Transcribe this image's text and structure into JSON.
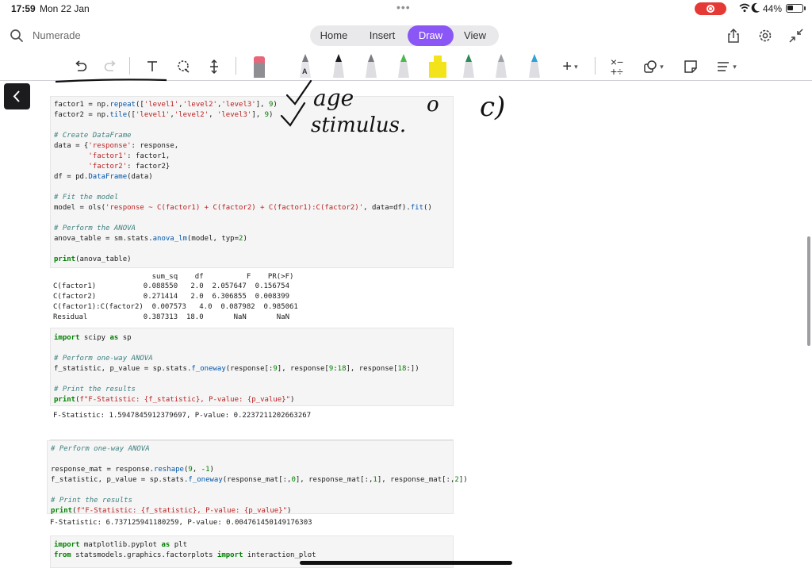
{
  "status": {
    "time": "17:59",
    "date": "Mon 22 Jan",
    "battery": "44%",
    "battery_fraction": 0.44
  },
  "topbar": {
    "app_name": "Numerade",
    "tabs": [
      {
        "label": "Home"
      },
      {
        "label": "Insert"
      },
      {
        "label": "Draw",
        "active": true
      },
      {
        "label": "View"
      }
    ]
  },
  "toolbar": {
    "tools": [
      "undo-icon",
      "redo-icon",
      "text-tool-icon",
      "lasso-icon",
      "insert-space-icon",
      "eraser-icon",
      "pen-icon",
      "pencil-icon",
      "highlighter-icon",
      "add-icon",
      "math-icon",
      "shapes-icon",
      "sticky-note-icon",
      "ink-to-text-icon"
    ],
    "pen_colors": [
      "#7a7a80",
      "#1c1c1e",
      "#7a7a80",
      "#4ab84a",
      "#f2e31a",
      "#2e8b57",
      "#9aa0a6",
      "#2fa3d8"
    ]
  },
  "colors": {
    "accent": "#8a56f5",
    "record": "#e53935"
  },
  "notebook": {
    "cell1": {
      "lines": [
        [
          [
            "t",
            "factor1 = np."
          ],
          [
            "fn",
            "repeat"
          ],
          [
            "t",
            "(["
          ],
          [
            "st",
            "'level1'"
          ],
          [
            "t",
            ","
          ],
          [
            "st",
            "'level2'"
          ],
          [
            "t",
            ","
          ],
          [
            "st",
            "'level3'"
          ],
          [
            "t",
            "], "
          ],
          [
            "nu",
            "9"
          ],
          [
            "t",
            ")"
          ]
        ],
        [
          [
            "t",
            "factor2 = np."
          ],
          [
            "fn",
            "tile"
          ],
          [
            "t",
            "(["
          ],
          [
            "st",
            "'level1'"
          ],
          [
            "t",
            ","
          ],
          [
            "st",
            "'level2'"
          ],
          [
            "t",
            ", "
          ],
          [
            "st",
            "'level3'"
          ],
          [
            "t",
            "], "
          ],
          [
            "nu",
            "9"
          ],
          [
            "t",
            ")"
          ]
        ],
        [
          [
            "t",
            ""
          ]
        ],
        [
          [
            "cm",
            "# Create DataFrame"
          ]
        ],
        [
          [
            "t",
            "data = {"
          ],
          [
            "st",
            "'response'"
          ],
          [
            "t",
            ": response,"
          ]
        ],
        [
          [
            "t",
            "        "
          ],
          [
            "st",
            "'factor1'"
          ],
          [
            "t",
            ": factor1,"
          ]
        ],
        [
          [
            "t",
            "        "
          ],
          [
            "st",
            "'factor2'"
          ],
          [
            "t",
            ": factor2}"
          ]
        ],
        [
          [
            "t",
            "df = pd."
          ],
          [
            "fn",
            "DataFrame"
          ],
          [
            "t",
            "(data)"
          ]
        ],
        [
          [
            "t",
            ""
          ]
        ],
        [
          [
            "cm",
            "# Fit the model"
          ]
        ],
        [
          [
            "t",
            "model = ols("
          ],
          [
            "st",
            "'response ~ C(factor1) + C(factor2) + C(factor1):C(factor2)'"
          ],
          [
            "t",
            ", data=df)."
          ],
          [
            "fn",
            "fit"
          ],
          [
            "t",
            "()"
          ]
        ],
        [
          [
            "t",
            ""
          ]
        ],
        [
          [
            "cm",
            "# Perform the ANOVA"
          ]
        ],
        [
          [
            "t",
            "anova_table = sm.stats."
          ],
          [
            "fn",
            "anova_lm"
          ],
          [
            "t",
            "(model, typ="
          ],
          [
            "nu",
            "2"
          ],
          [
            "t",
            ")"
          ]
        ],
        [
          [
            "t",
            ""
          ]
        ],
        [
          [
            "kw",
            "print"
          ],
          [
            "t",
            "(anova_table)"
          ]
        ]
      ]
    },
    "anova_output": {
      "header": "                       sum_sq    df          F    PR(>F)",
      "rows": [
        "C(factor1)           0.088550   2.0  2.057647  0.156754",
        "C(factor2)           0.271414   2.0  6.306855  0.008399",
        "C(factor1):C(factor2)  0.007573   4.0  0.087982  0.985061",
        "Residual             0.387313  18.0       NaN       NaN"
      ]
    },
    "cell2": {
      "lines": [
        [
          [
            "kw",
            "import"
          ],
          [
            "t",
            " scipy "
          ],
          [
            "kw",
            "as"
          ],
          [
            "t",
            " sp"
          ]
        ],
        [
          [
            "t",
            ""
          ]
        ],
        [
          [
            "cm",
            "# Perform one-way ANOVA"
          ]
        ],
        [
          [
            "t",
            "f_statistic, p_value = sp.stats."
          ],
          [
            "fn",
            "f_oneway"
          ],
          [
            "t",
            "(response[:"
          ],
          [
            "nu",
            "9"
          ],
          [
            "t",
            "], response["
          ],
          [
            "nu",
            "9"
          ],
          [
            "t",
            ":"
          ],
          [
            "nu",
            "18"
          ],
          [
            "t",
            "], response["
          ],
          [
            "nu",
            "18"
          ],
          [
            "t",
            ":])"
          ]
        ],
        [
          [
            "t",
            ""
          ]
        ],
        [
          [
            "cm",
            "# Print the results"
          ]
        ],
        [
          [
            "kw",
            "print"
          ],
          [
            "t",
            "("
          ],
          [
            "st",
            "f\"F-Statistic: {f_statistic}, P-value: {p_value}\""
          ],
          [
            "t",
            ")"
          ]
        ]
      ]
    },
    "output2": "F-Statistic: 1.5947845912379697, P-value: 0.2237211202663267",
    "cell3": {
      "lines": [
        [
          [
            "cm",
            "# Perform one-way ANOVA"
          ]
        ],
        [
          [
            "t",
            ""
          ]
        ],
        [
          [
            "t",
            "response_mat = response."
          ],
          [
            "fn",
            "reshape"
          ],
          [
            "t",
            "("
          ],
          [
            "nu",
            "9"
          ],
          [
            "t",
            ", -"
          ],
          [
            "nu",
            "1"
          ],
          [
            "t",
            ")"
          ]
        ],
        [
          [
            "t",
            "f_statistic, p_value = sp.stats."
          ],
          [
            "fn",
            "f_oneway"
          ],
          [
            "t",
            "(response_mat[:,"
          ],
          [
            "nu",
            "0"
          ],
          [
            "t",
            "], response_mat[:,"
          ],
          [
            "nu",
            "1"
          ],
          [
            "t",
            "], response_mat[:,"
          ],
          [
            "nu",
            "2"
          ],
          [
            "t",
            "])"
          ]
        ],
        [
          [
            "t",
            ""
          ]
        ],
        [
          [
            "cm",
            "# Print the results"
          ]
        ],
        [
          [
            "kw",
            "print"
          ],
          [
            "t",
            "("
          ],
          [
            "st",
            "f\"F-Statistic: {f_statistic}, P-value: {p_value}\""
          ],
          [
            "t",
            ")"
          ]
        ]
      ]
    },
    "output3": "F-Statistic: 6.737125941180259, P-value: 0.004761450149176303",
    "cell4": {
      "lines": [
        [
          [
            "kw",
            "import"
          ],
          [
            "t",
            " matplotlib.pyplot "
          ],
          [
            "kw",
            "as"
          ],
          [
            "t",
            " plt"
          ]
        ],
        [
          [
            "kw",
            "from"
          ],
          [
            "t",
            " statsmodels.graphics.factorplots "
          ],
          [
            "kw",
            "import"
          ],
          [
            "t",
            " interaction_plot"
          ]
        ]
      ]
    }
  },
  "handwriting": {
    "line1": "age",
    "line2": "stimulus.",
    "mark1": "o",
    "mark2": "c)"
  }
}
